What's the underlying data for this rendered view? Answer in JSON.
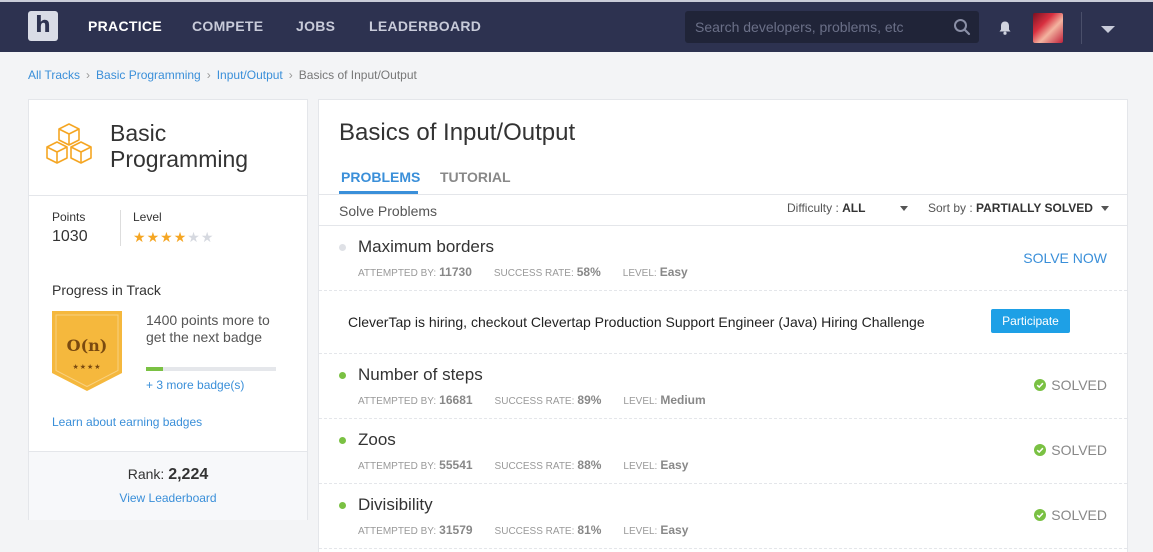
{
  "nav": {
    "logo": "h",
    "items": [
      "PRACTICE",
      "COMPETE",
      "JOBS",
      "LEADERBOARD"
    ],
    "search_placeholder": "Search developers, problems, etc"
  },
  "breadcrumb": [
    "All Tracks",
    "Basic Programming",
    "Input/Output",
    "Basics of Input/Output"
  ],
  "track": {
    "title": "Basic Programming",
    "points_label": "Points",
    "points_value": "1030",
    "level_label": "Level",
    "level_stars": 4,
    "level_stars_total": 6,
    "progress_title": "Progress in Track",
    "badge_label": "O(n)",
    "badge_stars": "★★★★",
    "badge_text": "1400 points more to get the next badge",
    "badge_progress": 0.13,
    "more_badges": "+ 3 more badge(s)",
    "learn_link": "Learn about earning badges",
    "rank_label": "Rank:",
    "rank_value": "2,224",
    "view_leaderboard": "View Leaderboard"
  },
  "main": {
    "title": "Basics of Input/Output",
    "tabs": [
      "PROBLEMS",
      "TUTORIAL"
    ],
    "solve_problems": "Solve Problems",
    "difficulty_label": "Difficulty :",
    "difficulty_value": "ALL",
    "sort_label": "Sort by :",
    "sort_value": "PARTIALLY SOLVED",
    "meta_labels": {
      "attempted": "ATTEMPTED BY:",
      "success": "SUCCESS RATE:",
      "level": "LEVEL:"
    },
    "problems": [
      {
        "name": "Maximum borders",
        "attempted": "11730",
        "success": "58%",
        "level": "Easy",
        "status": "SOLVE NOW"
      },
      {
        "name": "Number of steps",
        "attempted": "16681",
        "success": "89%",
        "level": "Medium",
        "status": "SOLVED"
      },
      {
        "name": "Zoos",
        "attempted": "55541",
        "success": "88%",
        "level": "Easy",
        "status": "SOLVED"
      },
      {
        "name": "Divisibility",
        "attempted": "31579",
        "success": "81%",
        "level": "Easy",
        "status": "SOLVED"
      }
    ],
    "hiring": {
      "text": "CleverTap is hiring, checkout Clevertap Production Support Engineer (Java) Hiring Challenge",
      "button": "Participate"
    }
  },
  "colors": {
    "nav_bg": "#2d3250",
    "link": "#3a8fd9",
    "solved_green": "#7ac143",
    "badge_orange": "#f5a623",
    "participate_blue": "#1ea0e6"
  }
}
